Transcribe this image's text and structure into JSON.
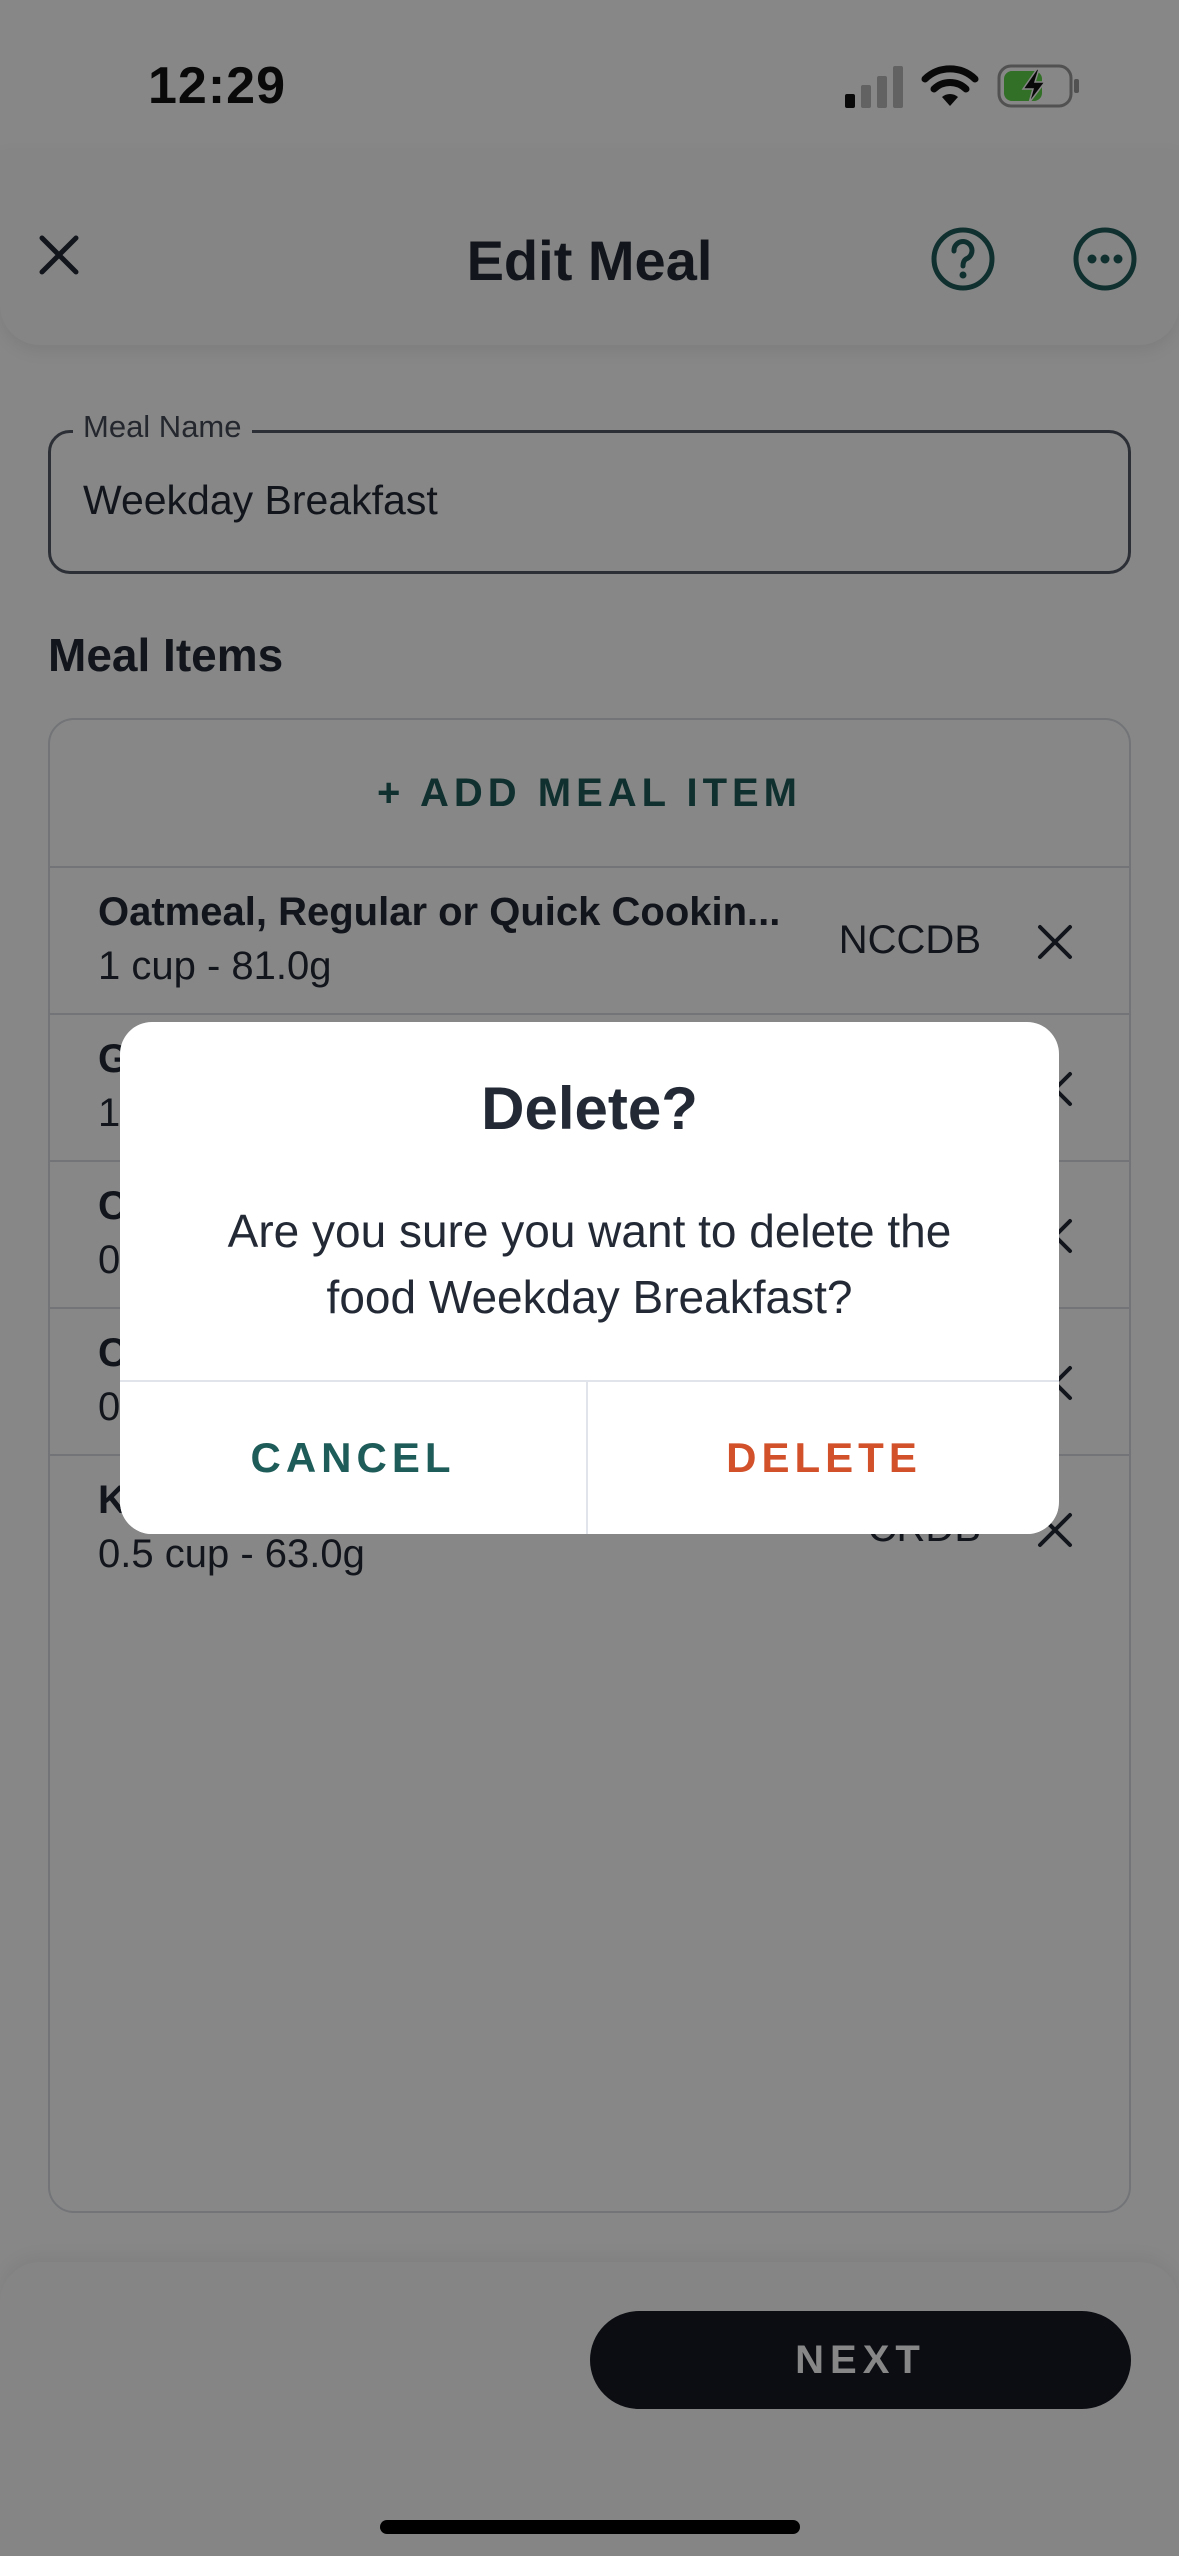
{
  "status_bar": {
    "time": "12:29"
  },
  "header": {
    "title": "Edit Meal"
  },
  "meal_name": {
    "label": "Meal Name",
    "value": "Weekday Breakfast"
  },
  "meal_items": {
    "title": "Meal Items",
    "add_label": "+ ADD MEAL ITEM",
    "items": [
      {
        "name": "Oatmeal, Regular or Quick Cookin...",
        "serving": "1 cup - 81.0g",
        "source": "NCCDB"
      },
      {
        "name": "G",
        "serving": "1.",
        "source": ""
      },
      {
        "name": "C",
        "serving": "0",
        "source": ""
      },
      {
        "name": "C",
        "serving": "0",
        "source": ""
      },
      {
        "name": "K",
        "serving": "0.5 cup - 63.0g",
        "source": "CRDB"
      }
    ]
  },
  "footer": {
    "next_label": "NEXT"
  },
  "dialog": {
    "title": "Delete?",
    "message": "Are you sure you want to delete the food Weekday Breakfast?",
    "cancel_label": "CANCEL",
    "delete_label": "DELETE"
  },
  "colors": {
    "accent_teal": "#1e5c59",
    "destructive": "#d2512b",
    "primary_button": "#161a24",
    "text_dark": "#232a36"
  }
}
